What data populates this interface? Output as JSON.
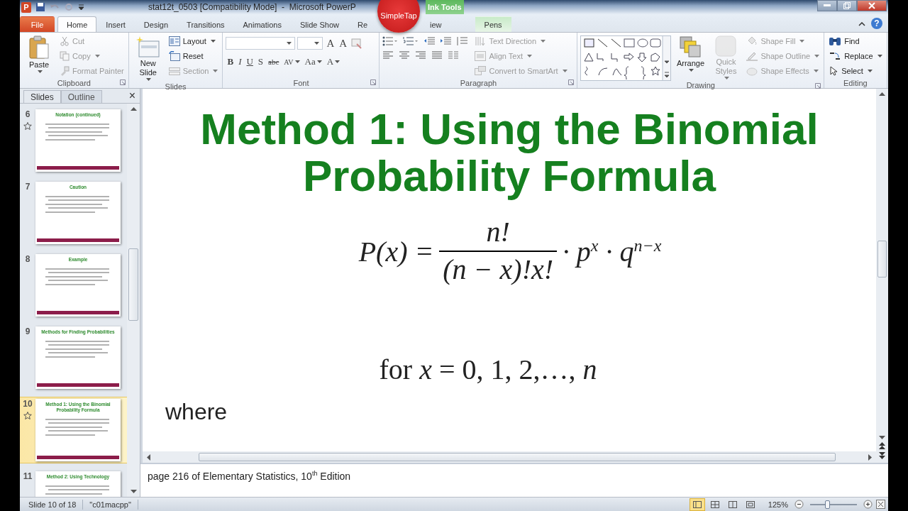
{
  "window": {
    "app_letter": "P",
    "title": "stat12t_0503 [Compatibility Mode]  -  Microsoft PowerP",
    "contextual_tab": "Ink Tools",
    "help": "?"
  },
  "overlay_badge": "SimpleTap",
  "tabs": [
    {
      "label": "File",
      "kind": "file",
      "selected": false
    },
    {
      "label": "Home",
      "kind": "tab",
      "selected": true
    },
    {
      "label": "Insert",
      "kind": "tab",
      "selected": false
    },
    {
      "label": "Design",
      "kind": "tab",
      "selected": false
    },
    {
      "label": "Transitions",
      "kind": "tab",
      "selected": false
    },
    {
      "label": "Animations",
      "kind": "tab",
      "selected": false
    },
    {
      "label": "Slide Show",
      "kind": "tab",
      "selected": false
    },
    {
      "label": "Re",
      "kind": "tab",
      "selected": false
    },
    {
      "label": "iew",
      "kind": "tab",
      "selected": false
    },
    {
      "label": "Pens",
      "kind": "contextual",
      "selected": false
    }
  ],
  "ribbon": [
    {
      "kind": "clipboard",
      "label": "Clipboard",
      "launcher": true,
      "large": [
        {
          "label": "Paste",
          "disabled": false,
          "dropdown": true
        }
      ],
      "small": [
        {
          "label": "Cut",
          "disabled": true,
          "dropdown": false
        },
        {
          "label": "Copy",
          "disabled": true,
          "dropdown": true
        },
        {
          "label": "Format Painter",
          "disabled": true,
          "dropdown": false
        }
      ]
    },
    {
      "kind": "slides",
      "label": "Slides",
      "launcher": false,
      "large": [
        {
          "label": "New Slide",
          "disabled": false,
          "dropdown": true
        }
      ],
      "small": [
        {
          "label": "Layout",
          "disabled": false,
          "dropdown": true
        },
        {
          "label": "Reset",
          "disabled": false,
          "dropdown": false
        },
        {
          "label": "Section",
          "disabled": true,
          "dropdown": true
        }
      ]
    },
    {
      "kind": "font",
      "label": "Font",
      "launcher": true,
      "top_glyphs": [
        {
          "label": "A",
          "dropdown": false
        },
        {
          "label": "A",
          "dropdown": false
        }
      ],
      "bottom_glyphs": [
        {
          "label": "B",
          "dropdown": false
        },
        {
          "label": "I",
          "dropdown": false
        },
        {
          "label": "U",
          "dropdown": false
        },
        {
          "label": "S",
          "dropdown": false
        },
        {
          "label": "abc",
          "dropdown": false
        },
        {
          "label": "AV",
          "dropdown": true
        },
        {
          "label": "Aa",
          "dropdown": true
        },
        {
          "label": "A",
          "dropdown": true
        }
      ]
    },
    {
      "kind": "paragraph",
      "label": "Paragraph",
      "launcher": true,
      "small": [
        {
          "label": "Text Direction",
          "disabled": true,
          "dropdown": true
        },
        {
          "label": "Align Text",
          "disabled": true,
          "dropdown": true
        },
        {
          "label": "Convert to SmartArt",
          "disabled": true,
          "dropdown": true
        }
      ]
    },
    {
      "kind": "drawing",
      "label": "Drawing",
      "launcher": true,
      "large": [
        {
          "label": "Arrange",
          "disabled": false,
          "dropdown": true
        },
        {
          "label": "Quick Styles",
          "disabled": true,
          "dropdown": true
        }
      ],
      "small": [
        {
          "label": "Shape Fill",
          "disabled": true,
          "dropdown": true
        },
        {
          "label": "Shape Outline",
          "disabled": true,
          "dropdown": true
        },
        {
          "label": "Shape Effects",
          "disabled": true,
          "dropdown": true
        }
      ]
    },
    {
      "kind": "editing",
      "label": "Editing",
      "launcher": false,
      "small": [
        {
          "label": "Find",
          "disabled": false,
          "dropdown": false
        },
        {
          "label": "Replace",
          "disabled": false,
          "dropdown": true
        },
        {
          "label": "Select",
          "disabled": false,
          "dropdown": true
        }
      ]
    }
  ],
  "pane": {
    "tabs": [
      {
        "label": "Slides",
        "selected": true
      },
      {
        "label": "Outline",
        "selected": false
      }
    ],
    "close": "×",
    "thumbnails": [
      {
        "number": "6",
        "title": "Notation (continued)",
        "selected": false,
        "animated": true
      },
      {
        "number": "7",
        "title": "Caution",
        "selected": false,
        "animated": false
      },
      {
        "number": "8",
        "title": "Example",
        "selected": false,
        "animated": false
      },
      {
        "number": "9",
        "title": "Methods  for Finding Probabilities",
        "selected": false,
        "animated": false
      },
      {
        "number": "10",
        "title": "Method  1: Using the Binomial Probability Formula",
        "selected": true,
        "animated": true
      },
      {
        "number": "11",
        "title": "Method  2: Using Technology",
        "selected": false,
        "animated": false
      }
    ]
  },
  "slide": {
    "title": "Method 1: Using the Binomial Probability Formula",
    "formula": {
      "lhs": "P(x) =",
      "numerator": "n!",
      "denominator": "(n − x)!x!",
      "rhs": "· p$^{x}$ · q$^{n−x}$"
    },
    "range": "for *x* = 0,  1, 2,…, *n*",
    "where": "where"
  },
  "notes": "page 216 of Elementary Statistics, 10$^{th}$ Edition",
  "status_bar": {
    "slide_info": "Slide 10 of 18",
    "theme": "\"c01macpp\"",
    "views": [
      {
        "selected": true
      },
      {
        "selected": false
      },
      {
        "selected": false
      },
      {
        "selected": false
      }
    ],
    "zoom": "125%",
    "level": 0.36
  }
}
